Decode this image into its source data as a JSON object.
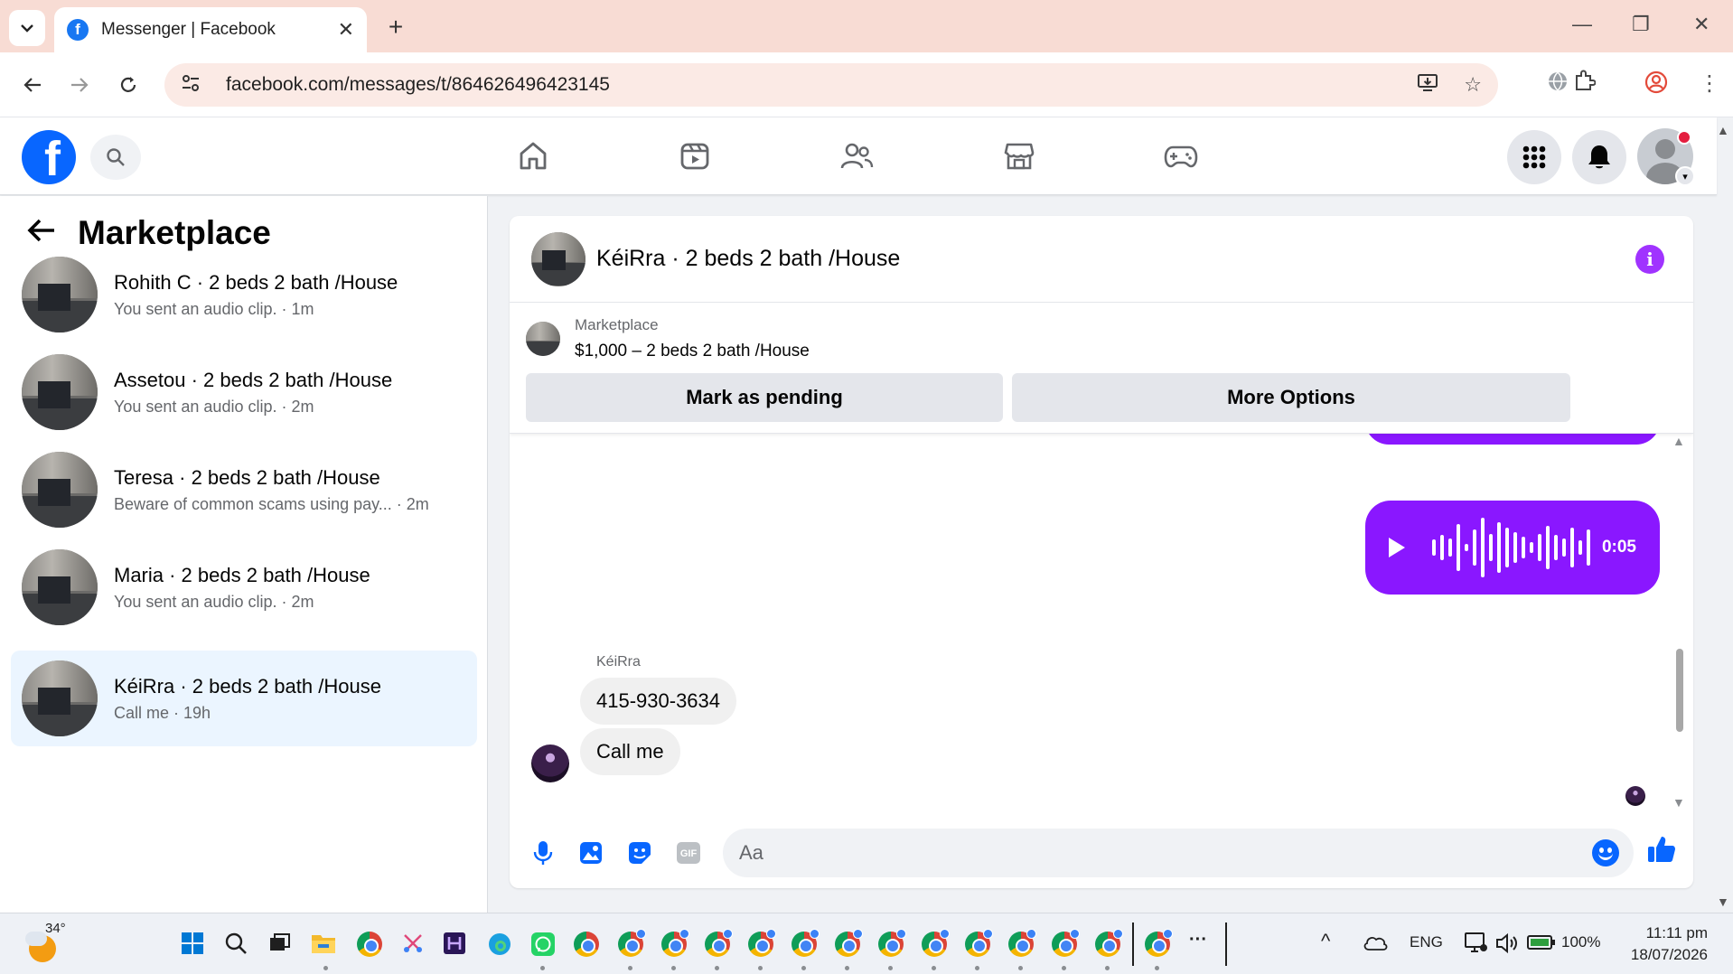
{
  "browser": {
    "tab_title": "Messenger | Facebook",
    "url": "facebook.com/messages/t/864626496423145",
    "tab_close_glyph": "✕",
    "new_tab_glyph": "+"
  },
  "sidebar": {
    "title": "Marketplace",
    "conversations": [
      {
        "name": "Rohith C · 2 beds 2 bath /House",
        "preview": "You sent an audio clip. · 1m"
      },
      {
        "name": "Assetou · 2 beds 2 bath /House",
        "preview": "You sent an audio clip. · 2m"
      },
      {
        "name": "Teresa · 2 beds 2 bath /House",
        "preview": "Beware of common scams using pay...  · 2m"
      },
      {
        "name": "Maria · 2 beds 2 bath /House",
        "preview": "You sent an audio clip. · 2m"
      },
      {
        "name": "KéiRra · 2 beds 2 bath /House",
        "preview": "Call me · 19h"
      }
    ]
  },
  "chat": {
    "title": "KéiRra · 2 beds 2 bath /House",
    "info_glyph": "i",
    "listing": {
      "label": "Marketplace",
      "price_title": "$1,000 – 2 beds 2 bath /House"
    },
    "buttons": {
      "mark_pending": "Mark as pending",
      "more_options": "More Options"
    },
    "audio_message": {
      "duration": "0:05"
    },
    "sender_name": "KéiRra",
    "messages": [
      {
        "text": "415-930-3634"
      },
      {
        "text": "Call me"
      }
    ],
    "composer_placeholder": "Aa"
  },
  "taskbar": {
    "temperature": "34°",
    "language": "ENG",
    "battery": "100%",
    "time": "11:11 pm",
    "date": "18/07/2026",
    "overflow_glyph": "···"
  },
  "colors": {
    "fb_blue": "#0866ff",
    "messenger_purple": "#8a17ff",
    "active_conversation": "#ebf5ff"
  }
}
